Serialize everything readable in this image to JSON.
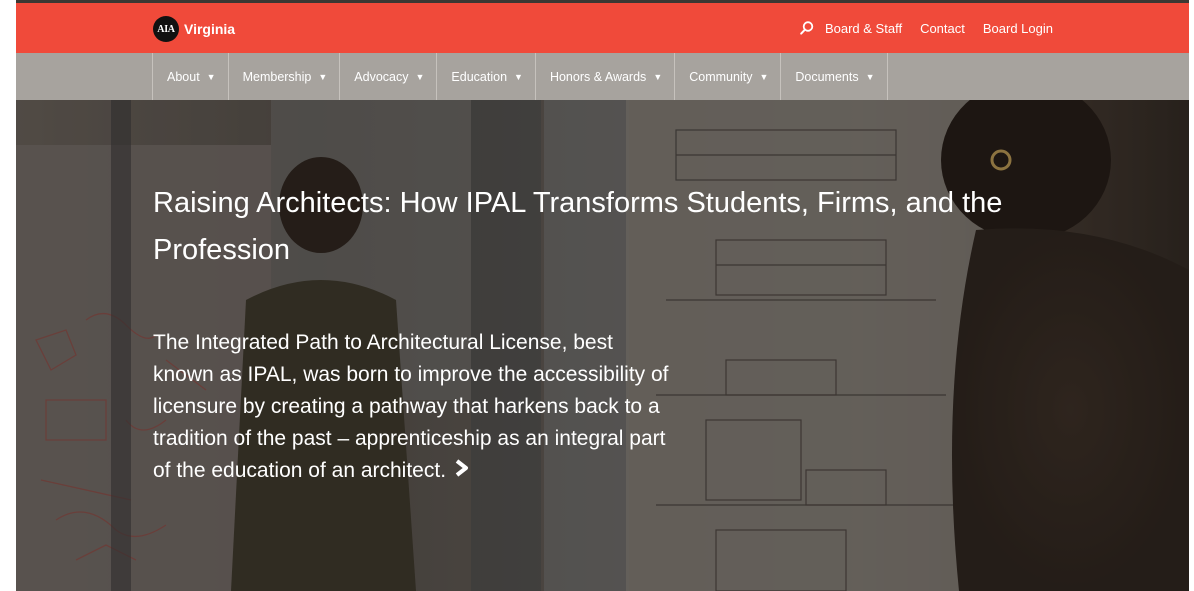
{
  "header": {
    "logo_mark": "AIA",
    "logo_text": "Virginia",
    "utility_links": [
      "Board & Staff",
      "Contact",
      "Board Login"
    ]
  },
  "nav": {
    "items": [
      "About",
      "Membership",
      "Advocacy",
      "Education",
      "Honors & Awards",
      "Community",
      "Documents"
    ]
  },
  "hero": {
    "title": "Raising Architects: How IPAL Transforms Students, Firms, and the Profession",
    "body": "The Integrated Path to Architectural License, best known as IPAL, was born to improve the accessibility of licensure by creating a pathway that harkens back to a tradition of the past – apprenticeship as an integral part of the education of an architect."
  },
  "colors": {
    "topbar": "#f04a3a",
    "navbar": "#a7a39e"
  },
  "icons": {
    "search": "search-icon",
    "dropdown": "caret-down-icon",
    "more": "chevron-right-icon"
  }
}
